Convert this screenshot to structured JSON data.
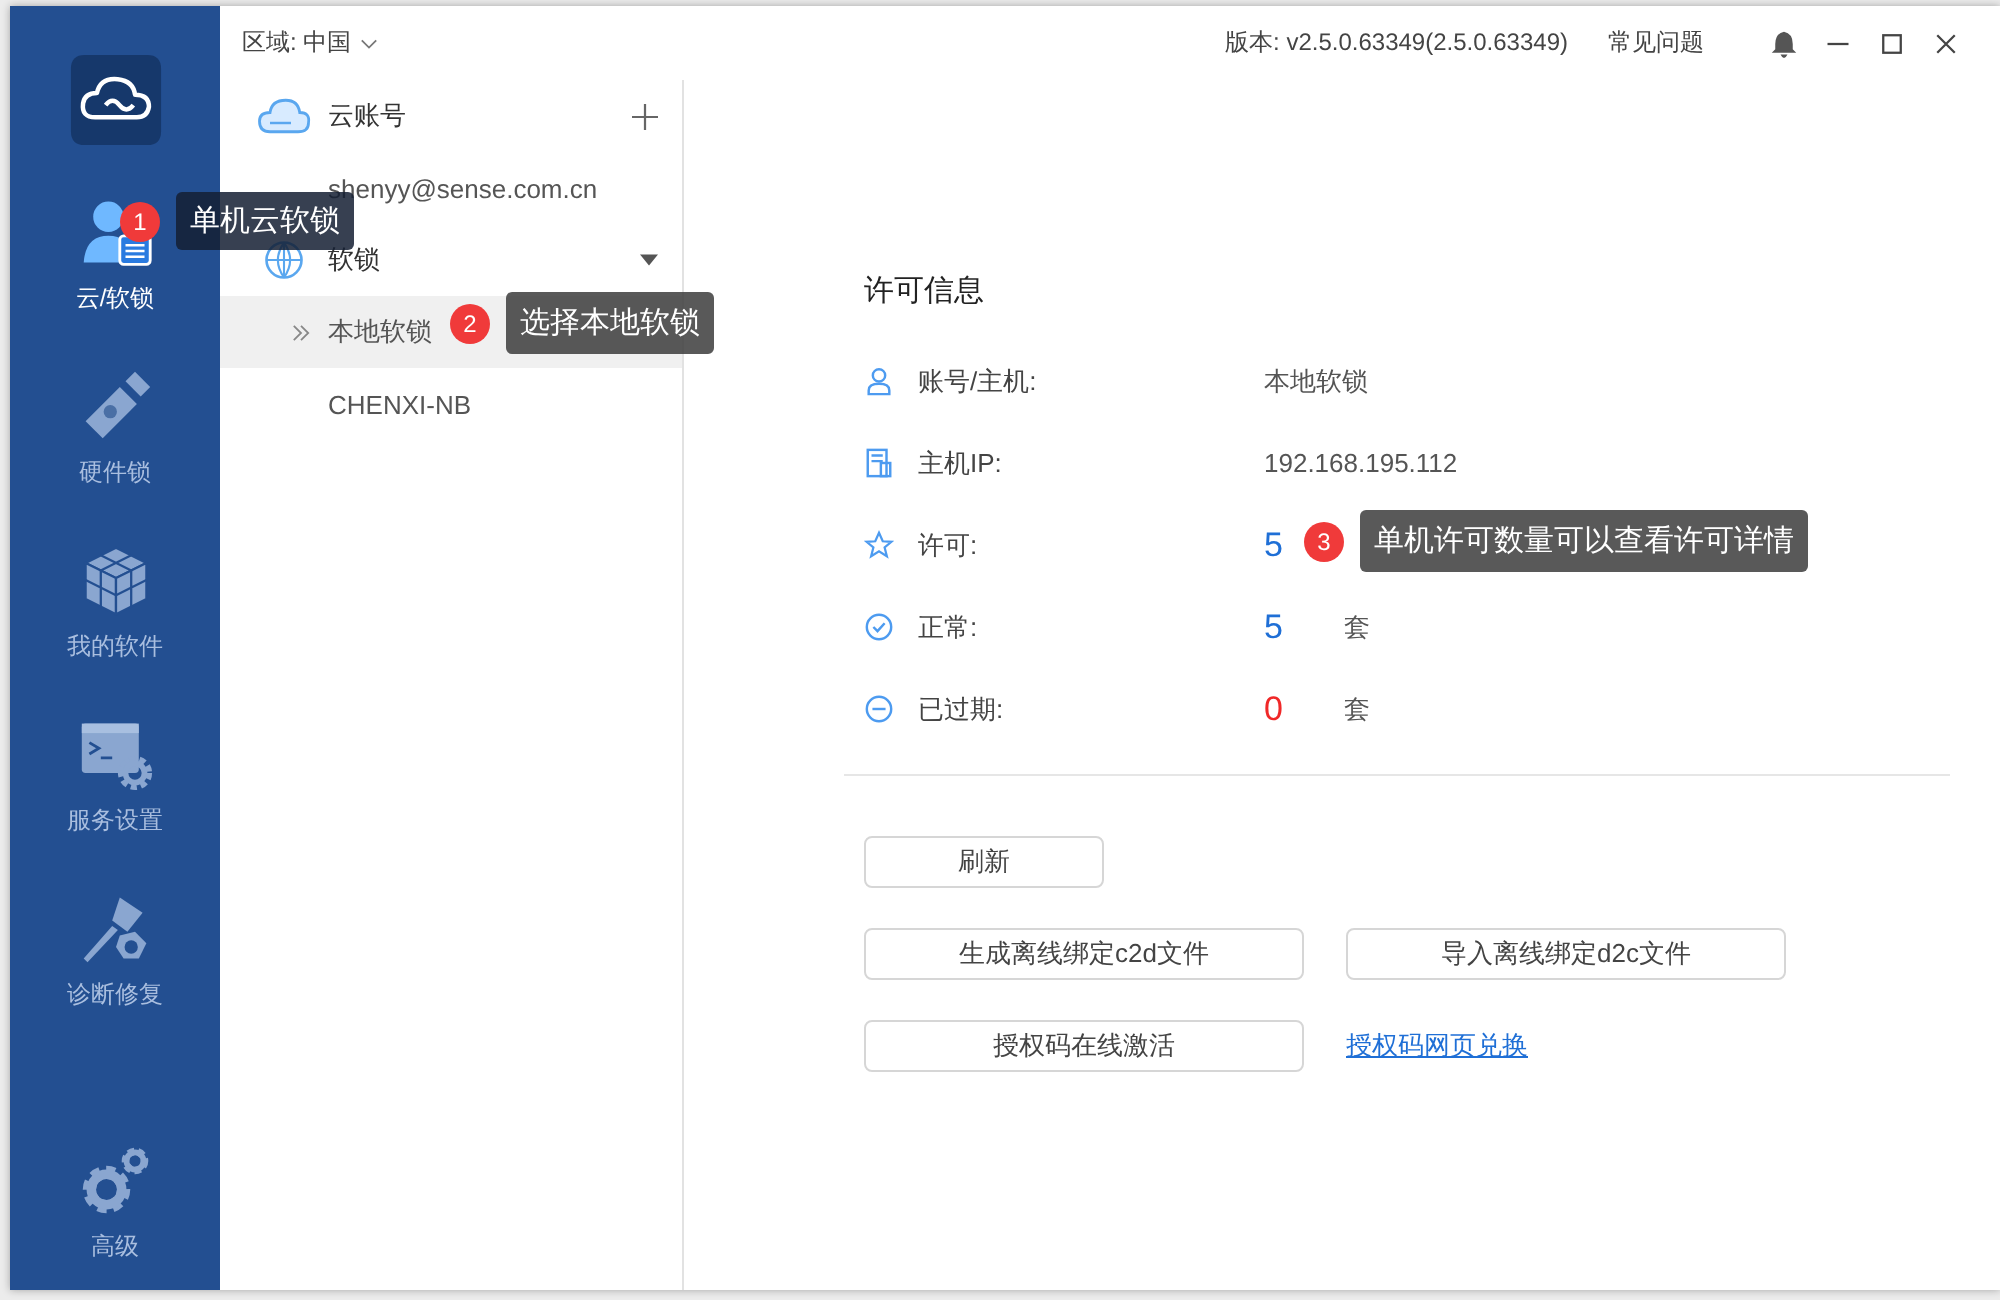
{
  "topbar": {
    "region_label": "区域:",
    "region_value": "中国",
    "version": "版本: v2.5.0.63349(2.5.0.63349)",
    "faq": "常见问题"
  },
  "nav": [
    {
      "kind": "cloud-user",
      "label": "云/软锁",
      "selected": true
    },
    {
      "kind": "usb",
      "label": "硬件锁",
      "selected": false
    },
    {
      "kind": "cubes",
      "label": "我的软件",
      "selected": false
    },
    {
      "kind": "terminal",
      "label": "服务设置",
      "selected": false
    },
    {
      "kind": "tools",
      "label": "诊断修复",
      "selected": false
    },
    {
      "kind": "gears",
      "label": "高级",
      "selected": false
    }
  ],
  "tree": [
    {
      "kind": "cloud",
      "label": "云账号",
      "children": [
        {
          "label": "shenyy@sense.com.cn",
          "selected": false
        }
      ]
    },
    {
      "kind": "globe",
      "label": "软锁",
      "expanded": true,
      "children": [
        {
          "label": "本地软锁",
          "selected": true
        },
        {
          "label": "CHENXI-NB",
          "selected": false
        }
      ]
    }
  ],
  "info": {
    "title": "许可信息",
    "rows": [
      {
        "kind": "user",
        "label": "账号/主机:",
        "value": "本地软锁",
        "color": "#555555"
      },
      {
        "kind": "server",
        "label": "主机IP:",
        "value": "192.168.195.112",
        "color": "#555555"
      },
      {
        "kind": "star",
        "label": "许可:",
        "value": "5",
        "color": "#1f6fd6"
      },
      {
        "kind": "check",
        "label": "正常:",
        "value": "5",
        "color": "#1f6fd6",
        "unit": "套"
      },
      {
        "kind": "minus",
        "label": "已过期:",
        "value": "0",
        "color": "#f02828",
        "unit": "套"
      }
    ]
  },
  "actions": [
    [
      {
        "kind": "button",
        "label": "刷新"
      }
    ],
    [
      {
        "kind": "button",
        "label": "生成离线绑定c2d文件"
      },
      {
        "kind": "button",
        "label": "导入离线绑定d2c文件"
      }
    ],
    [
      {
        "kind": "button",
        "label": "授权码在线激活"
      },
      {
        "kind": "link",
        "label": "授权码网页兑换"
      }
    ]
  ],
  "callouts": [
    {
      "number": "1",
      "text": "单机云软锁"
    },
    {
      "number": "2",
      "text": "选择本地软锁"
    },
    {
      "number": "3",
      "text": "单机许可数量可以查看许可详情"
    }
  ]
}
